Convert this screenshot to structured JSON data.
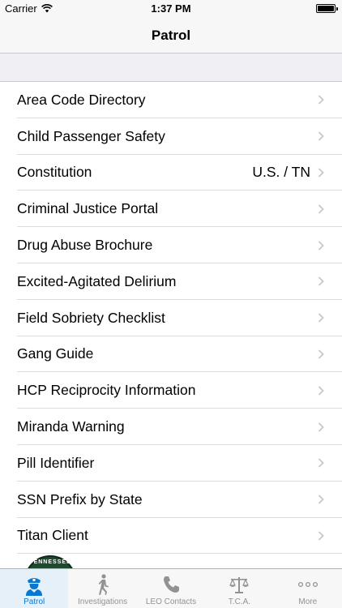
{
  "status_bar": {
    "carrier": "Carrier",
    "time": "1:37 PM"
  },
  "nav": {
    "title": "Patrol"
  },
  "rows": [
    {
      "label": "Area Code Directory",
      "detail": ""
    },
    {
      "label": "Child Passenger Safety",
      "detail": ""
    },
    {
      "label": "Constitution",
      "detail": "U.S. / TN"
    },
    {
      "label": "Criminal Justice Portal",
      "detail": ""
    },
    {
      "label": "Drug Abuse Brochure",
      "detail": ""
    },
    {
      "label": "Excited-Agitated Delirium",
      "detail": ""
    },
    {
      "label": "Field Sobriety Checklist",
      "detail": ""
    },
    {
      "label": "Gang Guide",
      "detail": ""
    },
    {
      "label": "HCP Reciprocity Information",
      "detail": ""
    },
    {
      "label": "Miranda Warning",
      "detail": ""
    },
    {
      "label": "Pill Identifier",
      "detail": ""
    },
    {
      "label": "SSN Prefix by State",
      "detail": ""
    },
    {
      "label": "Titan Client",
      "detail": ""
    }
  ],
  "seal": {
    "text": "TENNESSEE"
  },
  "tabs": [
    {
      "label": "Patrol",
      "icon": "police-officer-icon",
      "active": true
    },
    {
      "label": "Investigations",
      "icon": "walking-person-icon",
      "active": false
    },
    {
      "label": "LEO Contacts",
      "icon": "phone-icon",
      "active": false
    },
    {
      "label": "T.C.A.",
      "icon": "scales-icon",
      "active": false
    },
    {
      "label": "More",
      "icon": "more-dots-icon",
      "active": false
    }
  ],
  "colors": {
    "accent": "#0a78d0",
    "inactive_tab": "#929292",
    "background": "#efeff4"
  }
}
